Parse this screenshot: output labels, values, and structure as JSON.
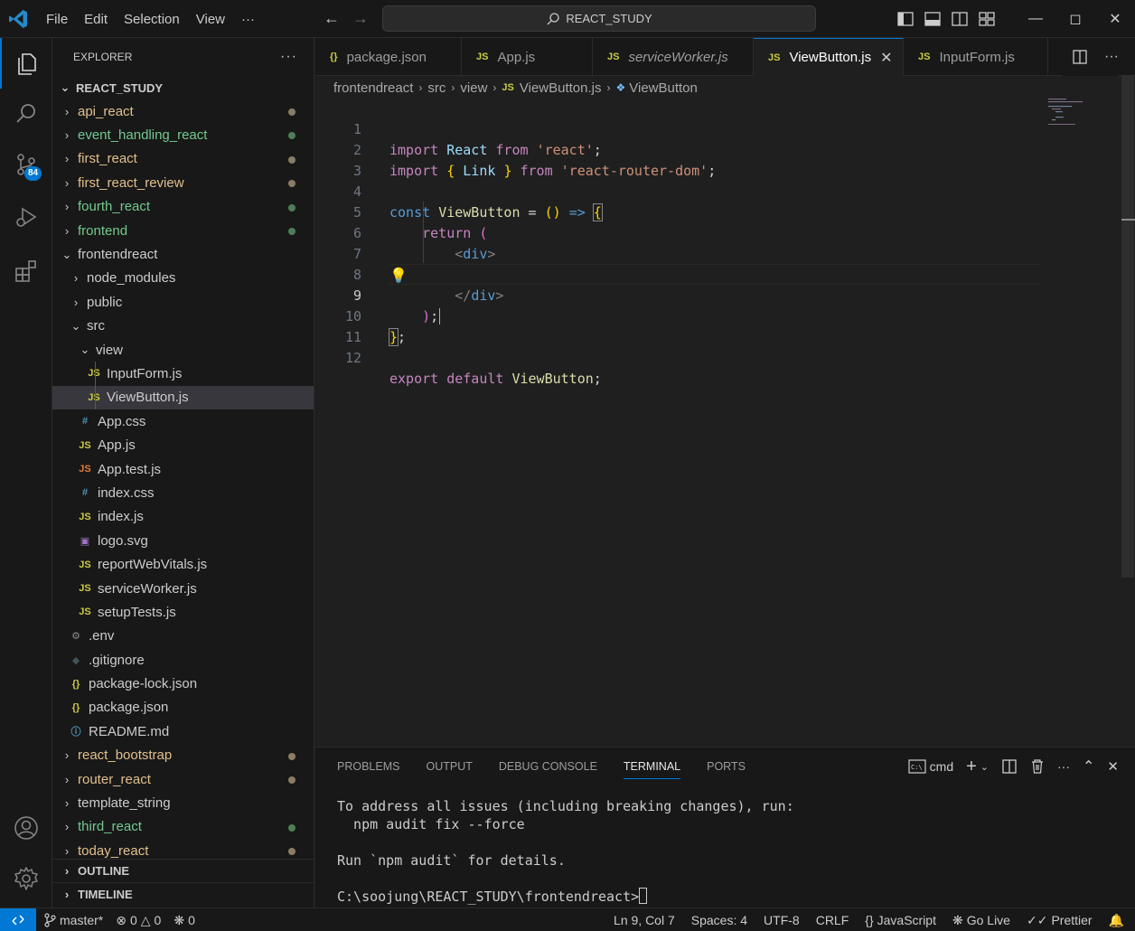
{
  "titlebar": {
    "menu": [
      "File",
      "Edit",
      "Selection",
      "View",
      "···"
    ],
    "search_text": "REACT_STUDY"
  },
  "activity": {
    "scm_badge": "84"
  },
  "explorer": {
    "title": "EXPLORER",
    "root": "REACT_STUDY",
    "items": [
      {
        "label": "api_react",
        "dot": "#8b7c65"
      },
      {
        "label": "event_handling_react",
        "dot": "#4e7e55"
      },
      {
        "label": "first_react",
        "dot": "#8b7c65"
      },
      {
        "label": "first_react_review",
        "dot": "#8b7c65"
      },
      {
        "label": "fourth_react",
        "dot": "#4e7e55"
      },
      {
        "label": "frontend",
        "dot": "#4e7e55"
      },
      {
        "label": "frontendreact"
      },
      {
        "label": "node_modules"
      },
      {
        "label": "public"
      },
      {
        "label": "src"
      },
      {
        "label": "view"
      },
      {
        "label": "InputForm.js"
      },
      {
        "label": "ViewButton.js"
      },
      {
        "label": "App.css"
      },
      {
        "label": "App.js"
      },
      {
        "label": "App.test.js"
      },
      {
        "label": "index.css"
      },
      {
        "label": "index.js"
      },
      {
        "label": "logo.svg"
      },
      {
        "label": "reportWebVitals.js"
      },
      {
        "label": "serviceWorker.js"
      },
      {
        "label": "setupTests.js"
      },
      {
        "label": ".env"
      },
      {
        "label": ".gitignore"
      },
      {
        "label": "package-lock.json"
      },
      {
        "label": "package.json"
      },
      {
        "label": "README.md"
      },
      {
        "label": "react_bootstrap",
        "dot": "#8b7c65"
      },
      {
        "label": "router_react",
        "dot": "#8b7c65"
      },
      {
        "label": "template_string"
      },
      {
        "label": "third_react",
        "dot": "#4e7e55"
      },
      {
        "label": "today_react",
        "dot": "#8b7c65"
      }
    ],
    "sections": [
      "OUTLINE",
      "TIMELINE"
    ]
  },
  "tabs": [
    {
      "label": "package.json",
      "icon": "{}"
    },
    {
      "label": "App.js",
      "icon": "JS"
    },
    {
      "label": "serviceWorker.js",
      "icon": "JS"
    },
    {
      "label": "ViewButton.js",
      "icon": "JS"
    },
    {
      "label": "InputForm.js",
      "icon": "JS"
    }
  ],
  "breadcrumb": [
    "frontendreact",
    "src",
    "view",
    "ViewButton.js",
    "ViewButton"
  ],
  "code": {
    "line_numbers": [
      "1",
      "2",
      "3",
      "4",
      "5",
      "6",
      "7",
      "8",
      "9",
      "10",
      "11",
      "12"
    ],
    "tokens": {
      "import": "import",
      "react_id": "React",
      "from": "from",
      "react_str": "'react'",
      "semi": ";",
      "link_open": "{",
      "link": "Link",
      "link_close": "}",
      "rrd_str": "'react-router-dom'",
      "const": "const",
      "view_button": "ViewButton",
      "eq": "=",
      "paren": "()",
      "arrow": "=>",
      "brace_open": "{",
      "return": "return",
      "ret_paren": "(",
      "div_open": "<div>",
      "div_close": "</div>",
      "close_paren": ")",
      "close_brace": "}",
      "export": "export",
      "default": "default"
    }
  },
  "panel": {
    "tabs": [
      "PROBLEMS",
      "OUTPUT",
      "DEBUG CONSOLE",
      "TERMINAL",
      "PORTS"
    ],
    "shell": "cmd",
    "terminal_lines": [
      "To address all issues (including breaking changes), run:",
      "  npm audit fix --force",
      "",
      "Run `npm audit` for details.",
      "",
      "C:\\soojung\\REACT_STUDY\\frontendreact>"
    ]
  },
  "status": {
    "branch": "master*",
    "errors": "0",
    "warnings": "0",
    "ports": "0",
    "position": "Ln 9, Col 7",
    "spaces": "Spaces: 4",
    "encoding": "UTF-8",
    "eol": "CRLF",
    "language": "JavaScript",
    "golive": "Go Live",
    "prettier": "Prettier"
  },
  "colors": {
    "accent": "#0078d4",
    "js_icon": "#cbcb41",
    "css_icon": "#519aba",
    "json_icon": "#cbcb41",
    "test_icon": "#e37933",
    "svg_icon": "#a074c4",
    "git_modified": "#8b7c65",
    "git_untracked": "#4e7e55"
  }
}
